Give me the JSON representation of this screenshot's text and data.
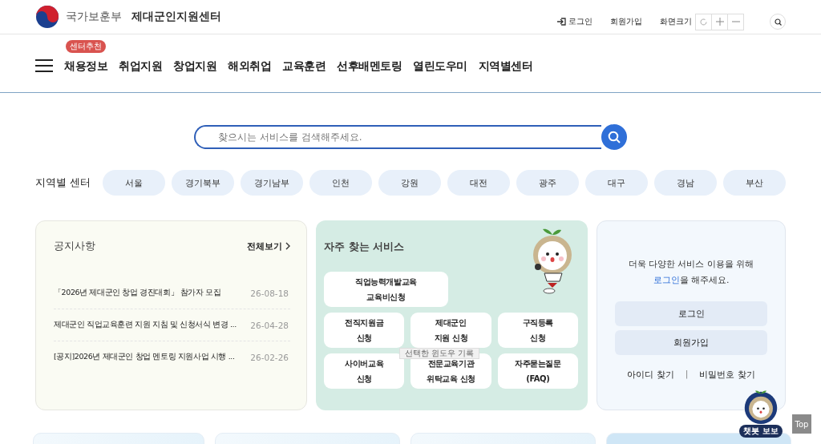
{
  "header": {
    "ministry": "국가보훈부",
    "site_title": "제대군인지원센터",
    "utility_links": [
      {
        "kind": "login",
        "label": "로그인"
      },
      {
        "kind": "plain",
        "label": "회원가입"
      }
    ],
    "font_size_label": "화면크기"
  },
  "nav": {
    "items": [
      {
        "label": "채용정보",
        "badge": "센터추천"
      },
      {
        "label": "취업지원"
      },
      {
        "label": "창업지원"
      },
      {
        "label": "해외취업"
      },
      {
        "label": "교육훈련"
      },
      {
        "label": "선후배멘토링"
      },
      {
        "label": "열린도우미"
      },
      {
        "label": "지역별센터"
      }
    ]
  },
  "search": {
    "placeholder": "찾으시는 서비스를 검색해주세요."
  },
  "regions": {
    "label": "지역별 센터",
    "items": [
      "서울",
      "경기북부",
      "경기남부",
      "인천",
      "강원",
      "대전",
      "광주",
      "대구",
      "경남",
      "부산"
    ]
  },
  "notices": {
    "title": "공지사항",
    "more": "전체보기",
    "items": [
      {
        "title": "「2026년 제대군인 창업 경진대회」 참가자 모집",
        "date": "26-08-18"
      },
      {
        "title": "제대군인 직업교육훈련 지원 지침 및 신청서식 변경 ...",
        "date": "26-04-28"
      },
      {
        "title": "[공지]2026년 제대군인 창업 멘토링 지원사업 시행 ...",
        "date": "26-02-26"
      }
    ]
  },
  "services": {
    "title": "자주 찾는 서비스",
    "items": [
      {
        "kind": "wide",
        "lines": [
          "직업능력개발교육",
          "교육비신청"
        ]
      },
      {
        "kind": "normal",
        "lines": [
          "전직지원금",
          "신청"
        ]
      },
      {
        "kind": "normal",
        "lines": [
          "제대군인",
          "지원 신청"
        ]
      },
      {
        "kind": "normal",
        "lines": [
          "구직등록",
          "신청"
        ]
      },
      {
        "kind": "normal",
        "lines": [
          "사이버교육",
          "신청"
        ]
      },
      {
        "kind": "normal",
        "lines": [
          "전문교육기관",
          "위탁교육 신청"
        ]
      },
      {
        "kind": "normal",
        "lines": [
          "자주묻는질문",
          "(FAQ)"
        ]
      }
    ],
    "tooltip": "선택한 윈도우 기록"
  },
  "login_box": {
    "message": "더욱 다양한 서비스 이용을 위해",
    "link": "로그인",
    "message_rest": "을 해주세요.",
    "buttons": [
      "로그인",
      "회원가입"
    ],
    "links": [
      "아이디 찾기",
      "비밀번호 찾기"
    ],
    "separator": "|"
  },
  "chatbot": {
    "label": "챗봇 보보"
  },
  "top_button": "Top"
}
